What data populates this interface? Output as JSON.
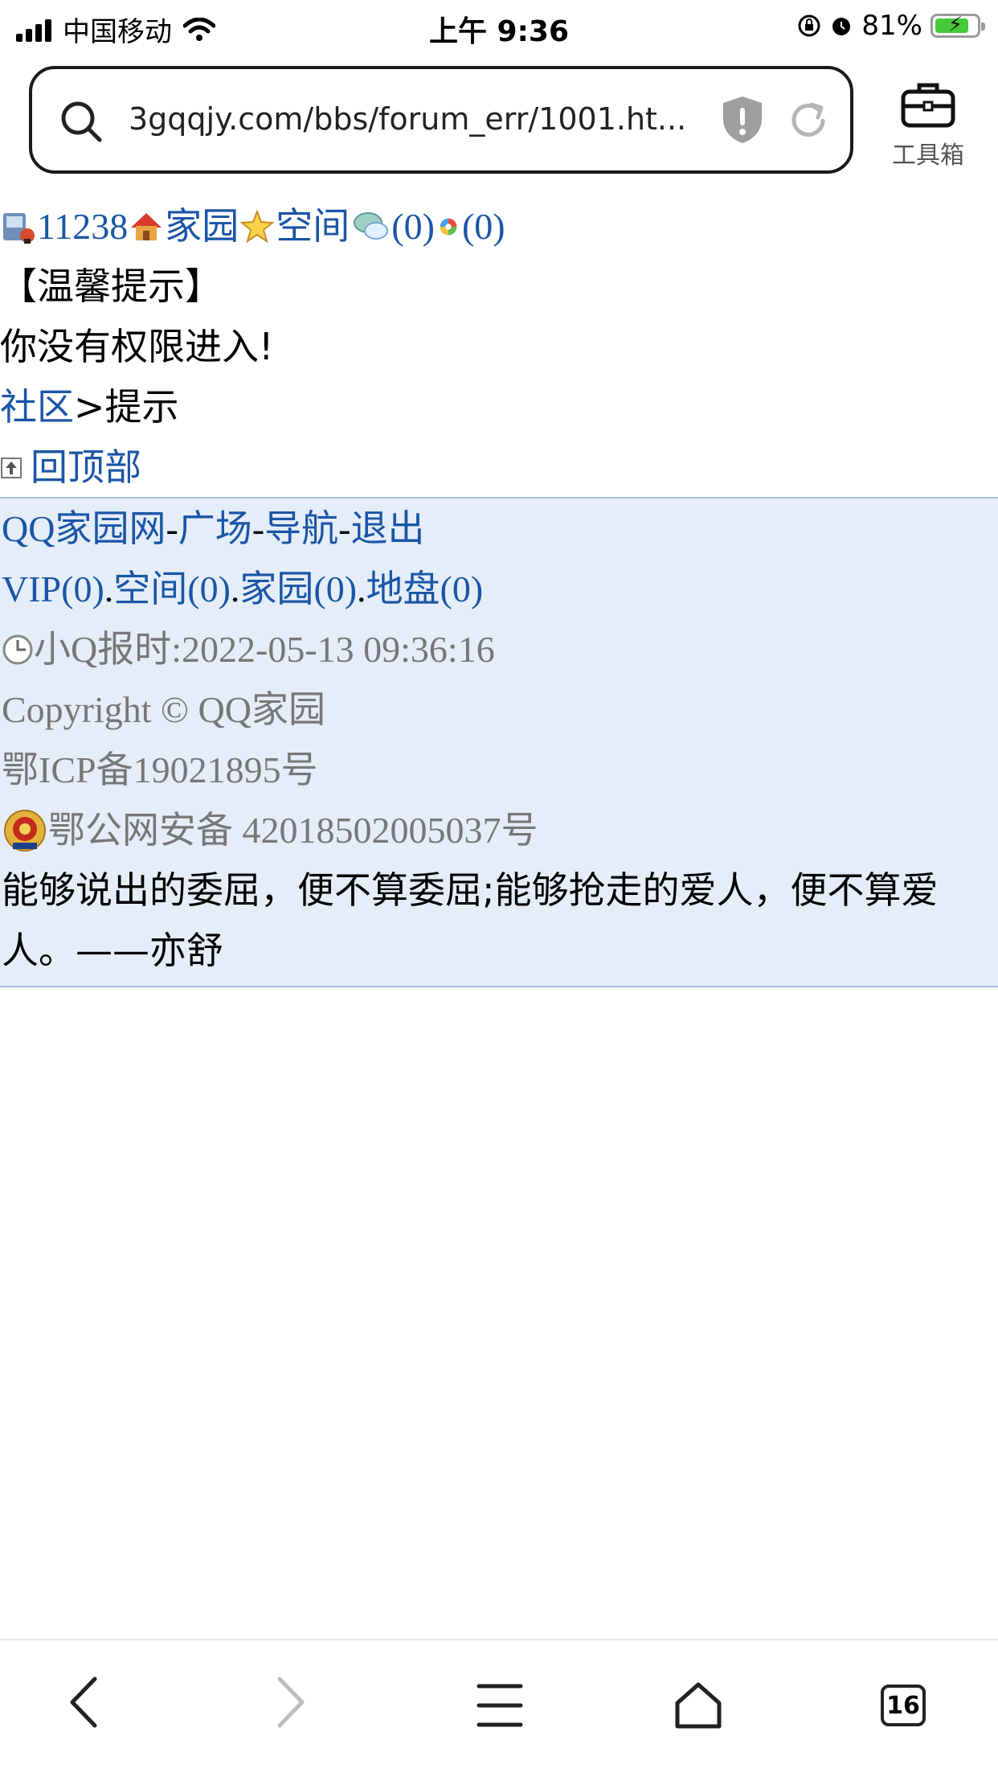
{
  "status": {
    "carrier": "中国移动",
    "time": "上午 9:36",
    "battery": "81%",
    "battery_level": 0.81
  },
  "browser": {
    "url": "3gqqjy.com/bbs/forum_err/1001.ht...",
    "toolbox_label": "工具箱",
    "tab_count": "16"
  },
  "header": {
    "user_id": "11238",
    "home": "家园",
    "space": "空间",
    "msg_count": "(0)",
    "friend_count": "(0)"
  },
  "notice": {
    "title": "【温馨提示】",
    "message": "你没有权限进入!"
  },
  "breadcrumb": {
    "community": "社区",
    "separator": ">提示"
  },
  "back_to_top": "回顶部",
  "footer": {
    "nav": {
      "site": "QQ家园网",
      "plaza": "广场",
      "guide": "导航",
      "logout": "退出",
      "sep": "-"
    },
    "stats": {
      "vip": "VIP(0)",
      "space": "空间(0)",
      "home": "家园(0)",
      "land": "地盘(0)",
      "sep": "."
    },
    "clock": "小Q报时:2022-05-13 09:36:16",
    "copyright": "Copyright © QQ家园",
    "icp": "鄂ICP备19021895号",
    "police": "鄂公网安备 42018502005037号",
    "quote": "能够说出的委屈，便不算委屈;能够抢走的爱人，便不算爱人。——亦舒"
  },
  "colors": {
    "link": "#1a55a6",
    "footer_bg": "#e5edf8",
    "battery_green": "#46c93a"
  }
}
